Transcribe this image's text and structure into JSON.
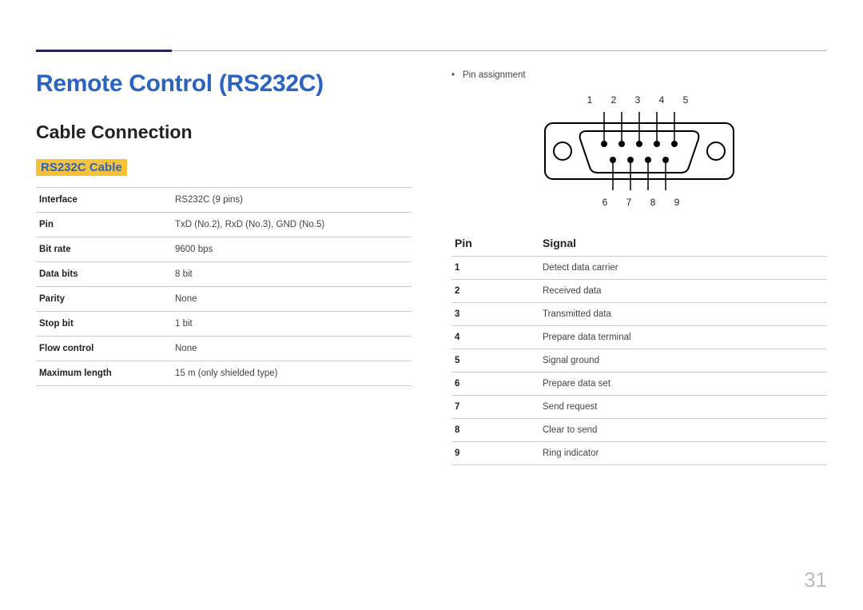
{
  "page_number": "31",
  "title": "Remote Control (RS232C)",
  "section": "Cable Connection",
  "subhead": "RS232C Cable",
  "spec_rows": [
    {
      "k": "Interface",
      "v": "RS232C (9 pins)"
    },
    {
      "k": "Pin",
      "v": "TxD (No.2), RxD (No.3), GND (No.5)"
    },
    {
      "k": "Bit rate",
      "v": "9600 bps"
    },
    {
      "k": "Data bits",
      "v": "8 bit"
    },
    {
      "k": "Parity",
      "v": "None"
    },
    {
      "k": "Stop bit",
      "v": "1 bit"
    },
    {
      "k": "Flow control",
      "v": "None"
    },
    {
      "k": "Maximum length",
      "v": "15 m (only shielded type)"
    }
  ],
  "right": {
    "bullet": "Pin assignment",
    "top_pins": "1  2  3  4  5",
    "bottom_pins": "6  7  8  9",
    "pin_header": {
      "pin": "Pin",
      "signal": "Signal"
    },
    "pin_rows": [
      {
        "n": "1",
        "s": "Detect data carrier"
      },
      {
        "n": "2",
        "s": "Received data"
      },
      {
        "n": "3",
        "s": "Transmitted data"
      },
      {
        "n": "4",
        "s": "Prepare data terminal"
      },
      {
        "n": "5",
        "s": "Signal ground"
      },
      {
        "n": "6",
        "s": "Prepare data set"
      },
      {
        "n": "7",
        "s": "Send request"
      },
      {
        "n": "8",
        "s": "Clear to send"
      },
      {
        "n": "9",
        "s": "Ring indicator"
      }
    ]
  }
}
